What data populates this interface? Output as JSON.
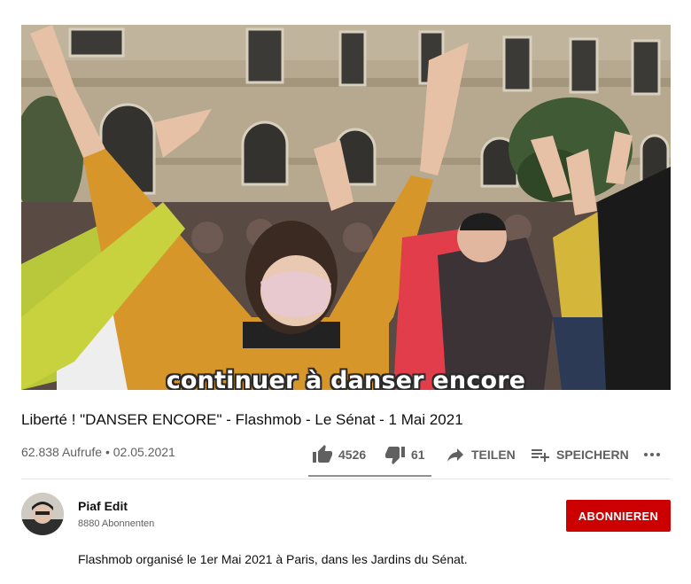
{
  "player": {
    "subtitle": "continuer à danser encore"
  },
  "video": {
    "title": "Liberté ! \"DANSER ENCORE\" - Flashmob - Le Sénat - 1 Mai 2021",
    "views": "62.838 Aufrufe",
    "separator": "•",
    "date": "02.05.2021"
  },
  "actions": {
    "likes": "4526",
    "dislikes": "61",
    "share_label": "TEILEN",
    "save_label": "SPEICHERN",
    "like_ratio": 0.987
  },
  "channel": {
    "name": "Piaf Edit",
    "subscribers": "8880 Abonnenten",
    "subscribe_label": "ABONNIEREN",
    "brand_color": "#cc0000"
  },
  "description": {
    "text": "Flashmob organisé le 1er Mai 2021 à Paris, dans les Jardins du Sénat."
  },
  "icons": {
    "like": "thumbs-up-icon",
    "dislike": "thumbs-down-icon",
    "share": "share-arrow-icon",
    "save": "playlist-add-icon",
    "more": "more-horizontal-icon"
  }
}
